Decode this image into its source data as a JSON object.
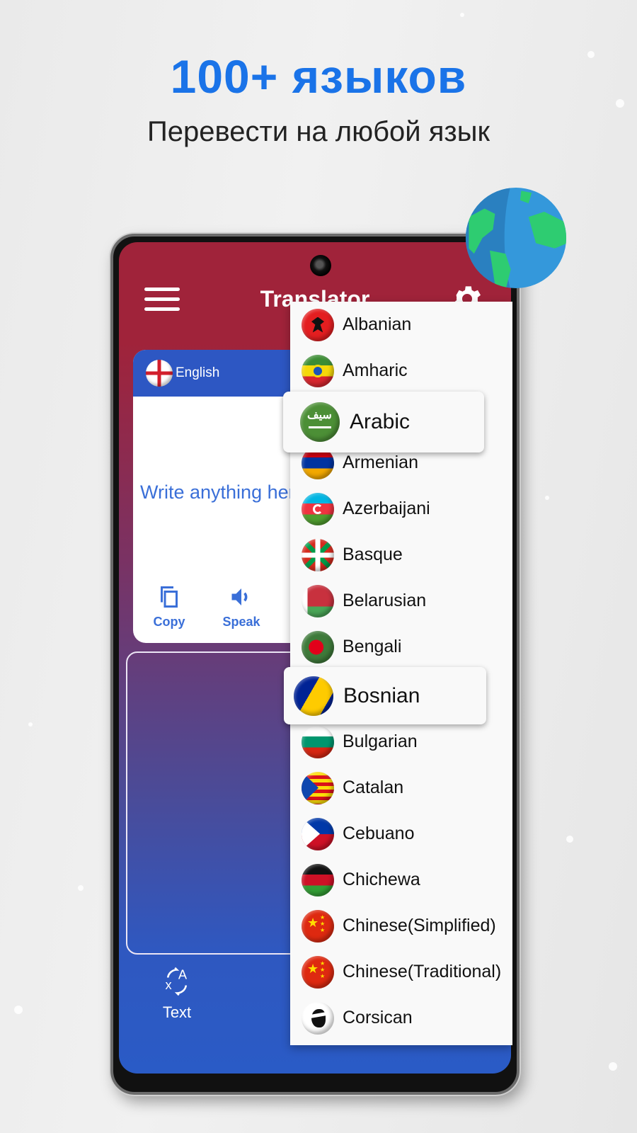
{
  "promo": {
    "headline": "100+ языков",
    "subline": "Перевести на любой язык",
    "accent_color": "#1a73e8"
  },
  "app": {
    "title": "Translator",
    "menu_icon": "hamburger-menu-icon",
    "settings_icon": "gear-icon",
    "header_color": "#a0233a",
    "primary_color": "#2d57c3"
  },
  "source": {
    "language": "English",
    "flag": "england-flag",
    "input_placeholder": "Write anything here",
    "actions": [
      {
        "label": "Copy",
        "icon": "copy-icon"
      },
      {
        "label": "Speak",
        "icon": "speaker-icon"
      }
    ]
  },
  "bottom_nav": [
    {
      "label": "Text",
      "icon": "translate-icon"
    }
  ],
  "language_dropdown": {
    "items": [
      {
        "label": "Albanian"
      },
      {
        "label": "Amharic"
      },
      {
        "label": "Arabic"
      },
      {
        "label": "Armenian"
      },
      {
        "label": "Azerbaijani"
      },
      {
        "label": "Basque"
      },
      {
        "label": "Belarusian"
      },
      {
        "label": "Bengali"
      },
      {
        "label": "Bosnian"
      },
      {
        "label": "Bulgarian"
      },
      {
        "label": "Catalan"
      },
      {
        "label": "Cebuano"
      },
      {
        "label": "Chichewa"
      },
      {
        "label": "Chinese(Simplified)"
      },
      {
        "label": "Chinese(Traditional)"
      },
      {
        "label": "Corsican"
      }
    ],
    "highlighted": [
      "Arabic",
      "Bosnian"
    ]
  }
}
